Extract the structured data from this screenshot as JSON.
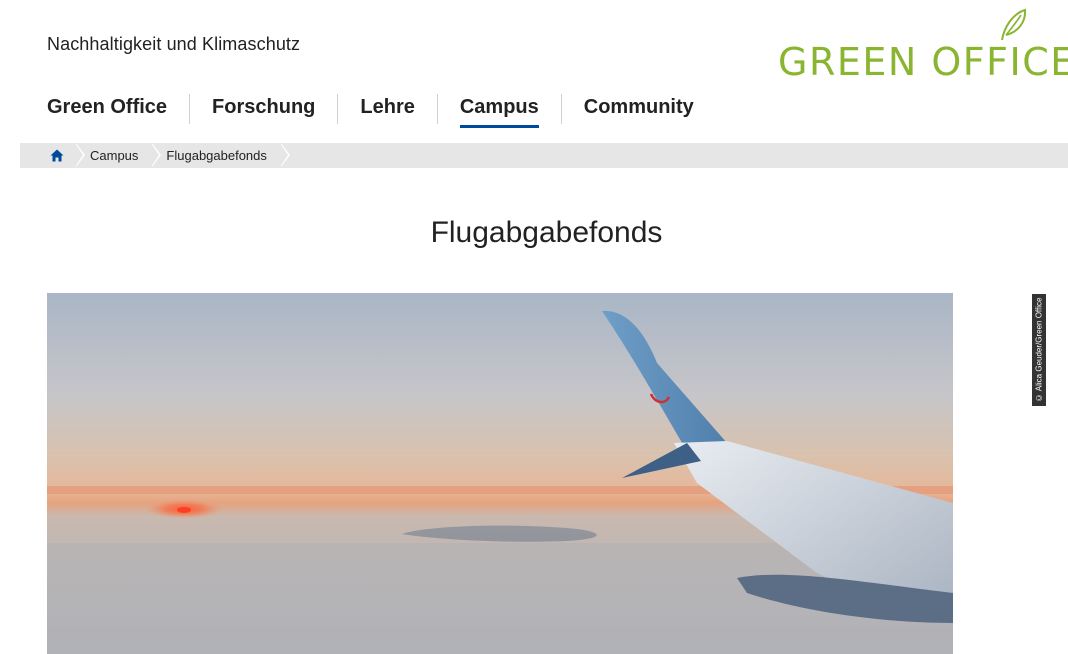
{
  "site": {
    "tagline": "Nachhaltigkeit und Klimaschutz",
    "logo_text": "GREEN OFFICE",
    "logo_color": "#8ab531",
    "logo_icon": "leaf-icon"
  },
  "nav": {
    "items": [
      {
        "label": "Green Office",
        "active": false
      },
      {
        "label": "Forschung",
        "active": false
      },
      {
        "label": "Lehre",
        "active": false
      },
      {
        "label": "Campus",
        "active": true
      },
      {
        "label": "Community",
        "active": false
      }
    ],
    "active_color": "#004a99"
  },
  "breadcrumb": {
    "home_icon": "home-icon",
    "items": [
      "Campus",
      "Flugabgabefonds"
    ]
  },
  "page": {
    "title": "Flugabgabefonds"
  },
  "hero": {
    "photo_credit": "© Alica Geuder/Green Office"
  }
}
